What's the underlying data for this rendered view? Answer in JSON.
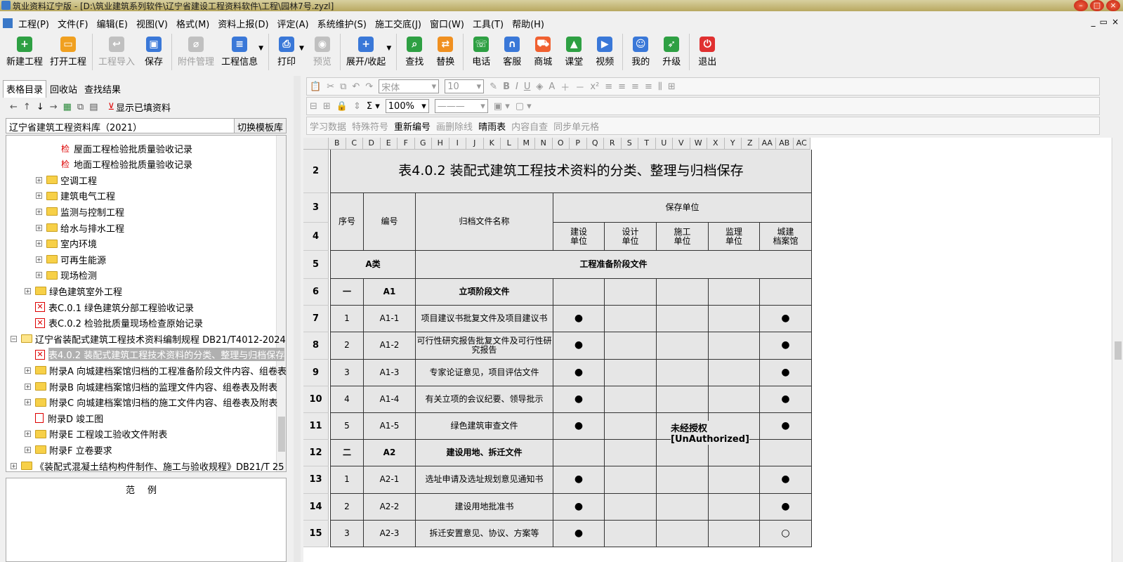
{
  "window": {
    "title": "筑业资料辽宁版 - [D:\\筑业建筑系列软件\\辽宁省建设工程资料软件\\工程\\园林7号.zyzl]"
  },
  "menu": [
    "工程(P)",
    "文件(F)",
    "编辑(E)",
    "视图(V)",
    "格式(M)",
    "资料上报(D)",
    "评定(A)",
    "系统维护(S)",
    "施工交底(J)",
    "窗口(W)",
    "工具(T)",
    "帮助(H)"
  ],
  "toolbar": [
    {
      "label": "新建工程",
      "color": "#2ea043",
      "icon": "plus-icon",
      "enabled": true
    },
    {
      "label": "打开工程",
      "color": "#f0a020",
      "icon": "folder-icon",
      "enabled": true
    },
    {
      "label": "工程导入",
      "color": "#c0c0c0",
      "icon": "import-icon",
      "enabled": false
    },
    {
      "label": "保存",
      "color": "#3a78d8",
      "icon": "save-icon",
      "enabled": true
    },
    {
      "label": "附件管理",
      "color": "#c0c0c0",
      "icon": "attach-icon",
      "enabled": false
    },
    {
      "label": "工程信息",
      "color": "#3a78d8",
      "icon": "list-icon",
      "enabled": true
    },
    {
      "label": "打印",
      "color": "#3a78d8",
      "icon": "print-icon",
      "enabled": true
    },
    {
      "label": "预览",
      "color": "#c0c0c0",
      "icon": "eye-icon",
      "enabled": false
    },
    {
      "label": "展开/收起",
      "color": "#3a78d8",
      "icon": "expand-icon",
      "enabled": true
    },
    {
      "label": "查找",
      "color": "#2ea043",
      "icon": "search-icon",
      "enabled": true
    },
    {
      "label": "替换",
      "color": "#f09020",
      "icon": "replace-icon",
      "enabled": true
    },
    {
      "label": "电话",
      "color": "#2ea043",
      "icon": "phone-icon",
      "enabled": true
    },
    {
      "label": "客服",
      "color": "#3a78d8",
      "icon": "headset-icon",
      "enabled": true
    },
    {
      "label": "商城",
      "color": "#f06030",
      "icon": "cart-icon",
      "enabled": true
    },
    {
      "label": "课堂",
      "color": "#2ea043",
      "icon": "class-icon",
      "enabled": true
    },
    {
      "label": "视频",
      "color": "#3a78d8",
      "icon": "video-icon",
      "enabled": true
    },
    {
      "label": "我的",
      "color": "#3a78d8",
      "icon": "user-icon",
      "enabled": true
    },
    {
      "label": "升级",
      "color": "#2ea043",
      "icon": "rocket-icon",
      "enabled": true
    },
    {
      "label": "退出",
      "color": "#e03030",
      "icon": "power-icon",
      "enabled": true
    }
  ],
  "left": {
    "tabs": [
      "表格目录",
      "回收站",
      "查找结果"
    ],
    "show_filled": "显示已填资料",
    "library": "辽宁省建筑工程资料库（2021）",
    "switch_btn": "切换模板库",
    "tree": [
      {
        "label": "屋面工程检验批质量验收记录",
        "kind": "jian",
        "indent": 3
      },
      {
        "label": "地面工程检验批质量验收记录",
        "kind": "jian",
        "indent": 3
      },
      {
        "label": "空调工程",
        "kind": "folder",
        "indent": 2
      },
      {
        "label": "建筑电气工程",
        "kind": "folder",
        "indent": 2
      },
      {
        "label": "监测与控制工程",
        "kind": "folder",
        "indent": 2
      },
      {
        "label": "给水与排水工程",
        "kind": "folder",
        "indent": 2
      },
      {
        "label": "室内环境",
        "kind": "folder",
        "indent": 2
      },
      {
        "label": "可再生能源",
        "kind": "folder",
        "indent": 2
      },
      {
        "label": "现场检测",
        "kind": "folder",
        "indent": 2
      },
      {
        "label": "绿色建筑室外工程",
        "kind": "folder",
        "indent": 1
      },
      {
        "label": "表C.0.1 绿色建筑分部工程验收记录",
        "kind": "redx",
        "indent": 1
      },
      {
        "label": "表C.0.2 检验批质量现场检查原始记录",
        "kind": "redx",
        "indent": 1
      },
      {
        "label": "辽宁省装配式建筑工程技术资料编制规程 DB21/T4012-2024",
        "kind": "folderopen",
        "indent": 0
      },
      {
        "label": "表4.0.2 装配式建筑工程技术资料的分类、整理与归档保存",
        "kind": "redx",
        "indent": 1,
        "selected": true
      },
      {
        "label": "附录A 向城建档案馆归档的工程准备阶段文件内容、组卷表",
        "kind": "folder",
        "indent": 1
      },
      {
        "label": "附录B 向城建档案馆归档的监理文件内容、组卷表及附表",
        "kind": "folder",
        "indent": 1
      },
      {
        "label": "附录C 向城建档案馆归档的施工文件内容、组卷表及附表",
        "kind": "folder",
        "indent": 1
      },
      {
        "label": "附录D 竣工图",
        "kind": "redpg",
        "indent": 1
      },
      {
        "label": "附录E 工程竣工验收文件附表",
        "kind": "folder",
        "indent": 1
      },
      {
        "label": "附录F 立卷要求",
        "kind": "folder",
        "indent": 1
      },
      {
        "label": "《装配式混凝土结构构件制作、施工与验收规程》DB21/T 25",
        "kind": "folder",
        "indent": 0
      }
    ],
    "legend_title": "范例"
  },
  "format": {
    "font": "宋体",
    "size": "10",
    "zoom": "100%",
    "row3": [
      "学习数据",
      "特殊符号",
      "重新编号",
      "画删除线",
      "晴雨表",
      "内容自查",
      "同步单元格"
    ]
  },
  "sheet": {
    "columns": [
      "B",
      "C",
      "D",
      "E",
      "F",
      "G",
      "H",
      "I",
      "J",
      "K",
      "L",
      "M",
      "N",
      "O",
      "P",
      "Q",
      "R",
      "S",
      "T",
      "U",
      "V",
      "W",
      "X",
      "Y",
      "Z",
      "AA",
      "AB",
      "AC"
    ],
    "title": "表4.0.2   装配式建筑工程技术资料的分类、整理与归档保存",
    "h_seq": "序号",
    "h_code": "编号",
    "h_name": "归档文件名称",
    "h_unit": "保存单位",
    "units": [
      "建设\n单位",
      "设计\n单位",
      "施工\n单位",
      "监理\n单位",
      "城建\n档案馆"
    ],
    "cat_a": "A类",
    "cat_a_name": "工程准备阶段文件",
    "watermark": "未经授权[UnAuthorized]",
    "rows": [
      {
        "row": "6",
        "seq": "一",
        "code": "A1",
        "name": "立项阶段文件",
        "bold": true,
        "marks": [
          "",
          "",
          "",
          "",
          ""
        ]
      },
      {
        "row": "7",
        "seq": "1",
        "code": "A1-1",
        "name": "项目建议书批复文件及项目建议书",
        "marks": [
          "●",
          "",
          "",
          "",
          "●"
        ]
      },
      {
        "row": "8",
        "seq": "2",
        "code": "A1-2",
        "name": "可行性研究报告批复文件及可行性研究报告",
        "marks": [
          "●",
          "",
          "",
          "",
          "●"
        ]
      },
      {
        "row": "9",
        "seq": "3",
        "code": "A1-3",
        "name": "专家论证意见，项目评估文件",
        "marks": [
          "●",
          "",
          "",
          "",
          "●"
        ]
      },
      {
        "row": "10",
        "seq": "4",
        "code": "A1-4",
        "name": "有关立项的会议纪要、领导批示",
        "marks": [
          "●",
          "",
          "",
          "",
          "●"
        ]
      },
      {
        "row": "11",
        "seq": "5",
        "code": "A1-5",
        "name": "绿色建筑审查文件",
        "marks": [
          "●",
          "",
          "",
          "",
          "●"
        ]
      },
      {
        "row": "12",
        "seq": "二",
        "code": "A2",
        "name": "建设用地、拆迁文件",
        "bold": true,
        "marks": [
          "",
          "",
          "",
          "",
          ""
        ]
      },
      {
        "row": "13",
        "seq": "1",
        "code": "A2-1",
        "name": "选址申请及选址规划意见通知书",
        "marks": [
          "●",
          "",
          "",
          "",
          "●"
        ]
      },
      {
        "row": "14",
        "seq": "2",
        "code": "A2-2",
        "name": "建设用地批准书",
        "marks": [
          "●",
          "",
          "",
          "",
          "●"
        ]
      },
      {
        "row": "15",
        "seq": "3",
        "code": "A2-3",
        "name": "拆迁安置意见、协议、方案等",
        "marks": [
          "●",
          "",
          "",
          "",
          "○"
        ]
      }
    ],
    "row_labels": [
      "2",
      "3",
      "4",
      "5"
    ]
  }
}
